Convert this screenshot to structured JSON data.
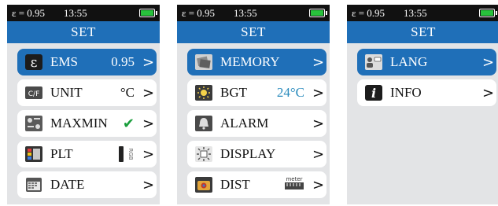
{
  "status": {
    "emissivity": "ε = 0.95",
    "time": "13:55"
  },
  "colors": {
    "header": "#1f6fb8",
    "selected": "#1f6fb8",
    "battery": "#28c23c",
    "check": "#1a9e3c",
    "value_blue": "#2a8bbd"
  },
  "screens": [
    {
      "title": "SET",
      "items": [
        {
          "label": "EMS",
          "value": "0.95",
          "icon": "epsilon-icon",
          "selected": true
        },
        {
          "label": "UNIT",
          "value": "°C",
          "icon": "cf-icon"
        },
        {
          "label": "MAXMIN",
          "value": "✔",
          "icon": "maxmin-icon"
        },
        {
          "label": "PLT",
          "value": "",
          "icon": "palette-icon",
          "extra_icon": "rgb-icon"
        },
        {
          "label": "DATE",
          "value": "",
          "icon": "calendar-icon"
        }
      ]
    },
    {
      "title": "SET",
      "items": [
        {
          "label": "MEMORY",
          "value": "",
          "icon": "memory-icon",
          "selected": true
        },
        {
          "label": "BGT",
          "value": "24°C",
          "icon": "sun-icon"
        },
        {
          "label": "ALARM",
          "value": "",
          "icon": "bell-icon"
        },
        {
          "label": "DISPLAY",
          "value": "",
          "icon": "display-icon"
        },
        {
          "label": "DIST",
          "value": "",
          "icon": "distance-icon",
          "extra_icon": "meter-icon"
        }
      ]
    },
    {
      "title": "SET",
      "items": [
        {
          "label": "LANG",
          "value": "",
          "icon": "language-icon",
          "selected": true
        },
        {
          "label": "INFO",
          "value": "",
          "icon": "info-icon"
        }
      ]
    }
  ],
  "extra": {
    "rgb_text": "RGB",
    "meter_text": "meter"
  },
  "arrow_glyph": ">"
}
